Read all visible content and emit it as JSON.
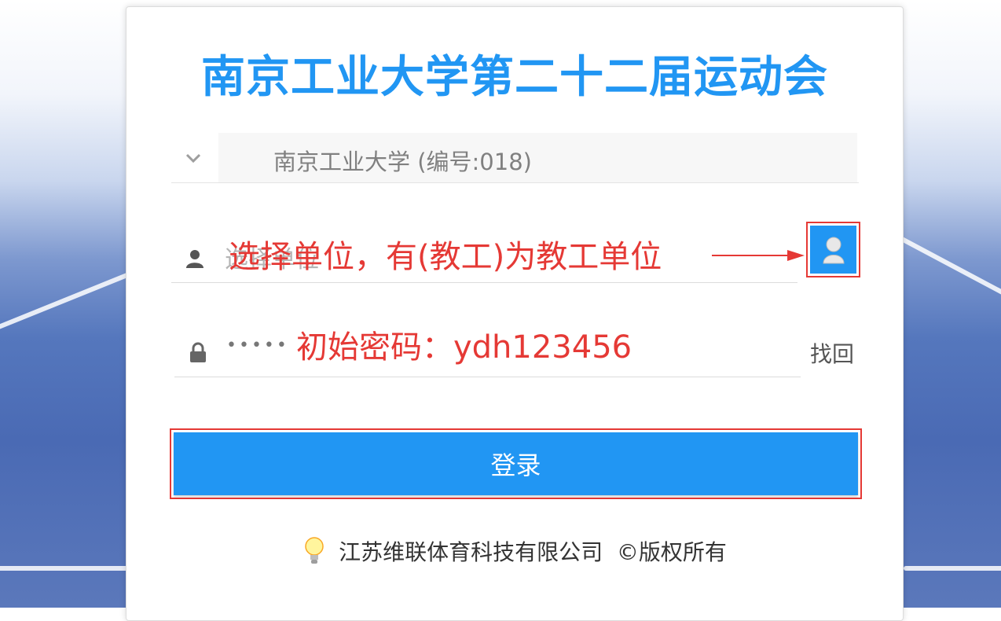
{
  "title": "南京工业大学第二十二届运动会",
  "unit_select": {
    "value": "南京工业大学 (编号:018)",
    "icon": "chevron-down-icon"
  },
  "user_field": {
    "placeholder": "选择单位",
    "icon": "user-icon"
  },
  "unit_button": {
    "icon": "user-avatar-icon"
  },
  "password_field": {
    "value": "•••••",
    "icon": "lock-icon"
  },
  "find_link": "找回",
  "annotations": {
    "unit_hint": "选择单位，有(教工)为教工单位",
    "password_hint": "初始密码：ydh123456"
  },
  "login_button": "登录",
  "footer": {
    "text": "江苏维联体育科技有限公司  ©版权所有",
    "icon": "lightbulb-icon"
  },
  "colors": {
    "accent": "#2196f3",
    "annotation": "#e53935"
  }
}
